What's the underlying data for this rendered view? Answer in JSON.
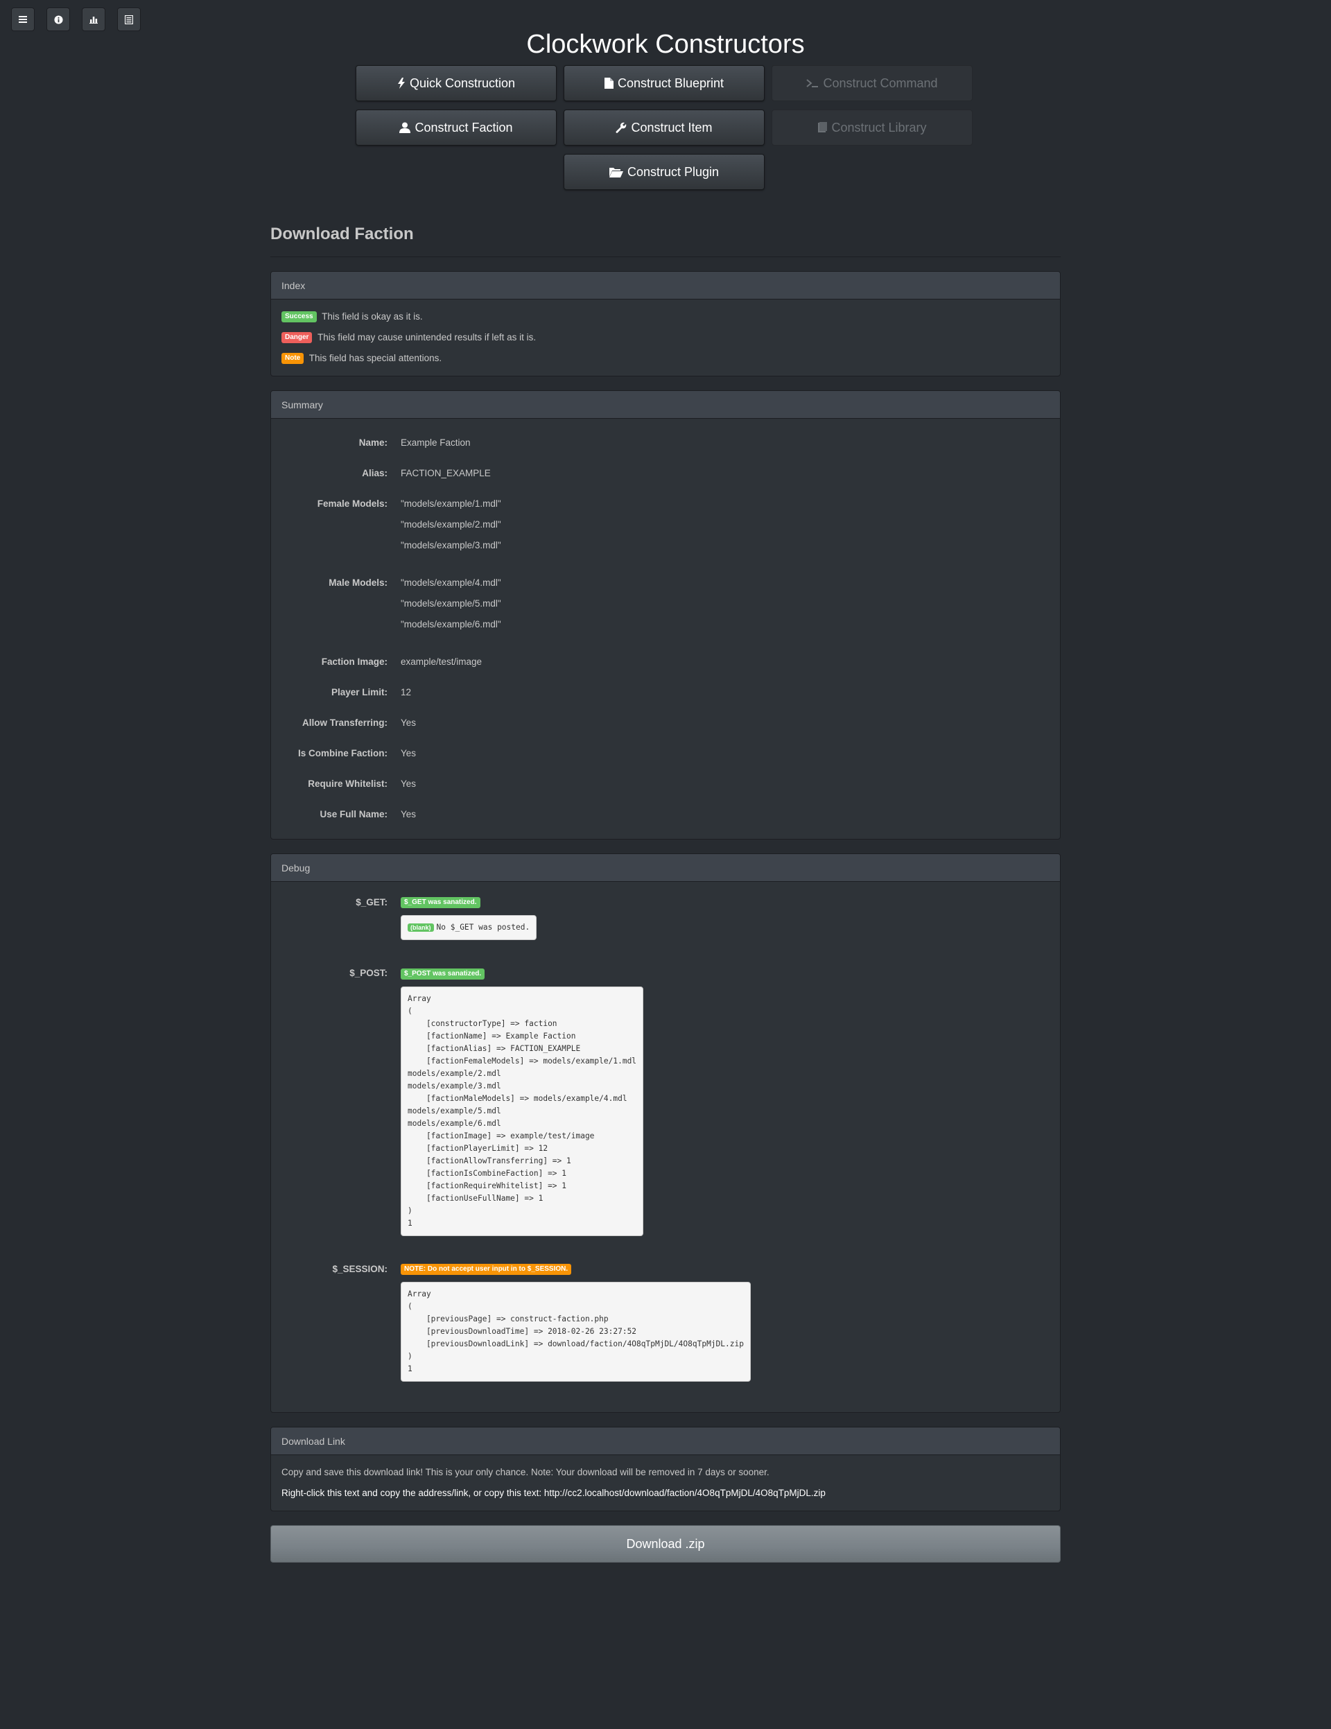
{
  "app": {
    "title": "Clockwork Constructors"
  },
  "toolbar_icons": [
    "menu-icon",
    "info-icon",
    "stats-icon",
    "list-icon"
  ],
  "nav": {
    "quick": "Quick Construction",
    "blueprint": "Construct Blueprint",
    "command": "Construct Command",
    "faction": "Construct Faction",
    "item": "Construct Item",
    "library": "Construct Library",
    "plugin": "Construct Plugin"
  },
  "page": {
    "heading": "Download Faction"
  },
  "index": {
    "title": "Index",
    "items": [
      {
        "label": "Success",
        "text": "This field is okay as it is."
      },
      {
        "label": "Danger",
        "text": "This field may cause unintended results if left as it is."
      },
      {
        "label": "Note",
        "text": "This field has special attentions."
      }
    ]
  },
  "summary": {
    "title": "Summary",
    "name_key": "Name:",
    "name": "Example Faction",
    "alias_key": "Alias:",
    "alias": "FACTION_EXAMPLE",
    "female_key": "Female Models:",
    "female": [
      "\"models/example/1.mdl\"",
      "\"models/example/2.mdl\"",
      "\"models/example/3.mdl\""
    ],
    "male_key": "Male Models:",
    "male": [
      "\"models/example/4.mdl\"",
      "\"models/example/5.mdl\"",
      "\"models/example/6.mdl\""
    ],
    "image_key": "Faction Image:",
    "image": "example/test/image",
    "limit_key": "Player Limit:",
    "limit": "12",
    "transfer_key": "Allow Transferring:",
    "transfer": "Yes",
    "combine_key": "Is Combine Faction:",
    "combine": "Yes",
    "whitelist_key": "Require Whitelist:",
    "whitelist": "Yes",
    "fullname_key": "Use Full Name:",
    "fullname": "Yes"
  },
  "debug": {
    "title": "Debug",
    "get_key": "$_GET:",
    "get_badge": "$_GET was sanatized.",
    "get_blank": "(blank)",
    "get_text": "No $_GET was posted.",
    "post_key": "$_POST:",
    "post_badge": "$_POST was sanatized.",
    "post_dump": "Array\n(\n    [constructorType] => faction\n    [factionName] => Example Faction\n    [factionAlias] => FACTION_EXAMPLE\n    [factionFemaleModels] => models/example/1.mdl\nmodels/example/2.mdl\nmodels/example/3.mdl\n    [factionMaleModels] => models/example/4.mdl\nmodels/example/5.mdl\nmodels/example/6.mdl\n    [factionImage] => example/test/image\n    [factionPlayerLimit] => 12\n    [factionAllowTransferring] => 1\n    [factionIsCombineFaction] => 1\n    [factionRequireWhitelist] => 1\n    [factionUseFullName] => 1\n)\n1",
    "session_key": "$_SESSION:",
    "session_badge": "NOTE: Do not accept user input in to $_SESSION.",
    "session_dump": "Array\n(\n    [previousPage] => construct-faction.php\n    [previousDownloadTime] => 2018-02-26 23:27:52\n    [previousDownloadLink] => download/faction/4O8qTpMjDL/4O8qTpMjDL.zip\n)\n1"
  },
  "download": {
    "title": "Download Link",
    "notice": "Copy and save this download link! This is your only chance. Note: Your download will be removed in 7 days or sooner.",
    "link_text": "Right-click this text and copy the address/link, or copy this text: http://cc2.localhost/download/faction/4O8qTpMjDL/4O8qTpMjDL.zip",
    "button": "Download .zip"
  }
}
